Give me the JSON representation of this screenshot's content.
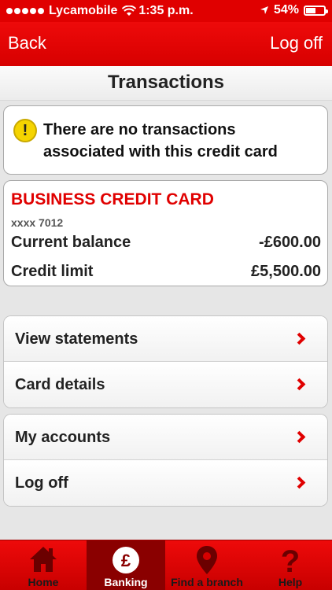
{
  "status_bar": {
    "carrier": "Lycamobile",
    "time": "1:35 p.m.",
    "battery": "54%"
  },
  "nav": {
    "back_label": "Back",
    "logoff_label": "Log off"
  },
  "page": {
    "title": "Transactions"
  },
  "info": {
    "message": "There are no transactions associated with this credit card"
  },
  "card": {
    "name": "BUSINESS CREDIT CARD",
    "number": "xxxx 7012",
    "balance_label": "Current balance",
    "balance_value": "-£600.00",
    "limit_label": "Credit limit",
    "limit_value": "£5,500.00"
  },
  "menu1": {
    "items": [
      {
        "label": "View statements"
      },
      {
        "label": "Card details"
      }
    ]
  },
  "menu2": {
    "items": [
      {
        "label": "My accounts"
      },
      {
        "label": "Log off"
      }
    ]
  },
  "tabs": [
    {
      "label": "Home",
      "icon": "home-icon"
    },
    {
      "label": "Banking",
      "icon": "pound-icon"
    },
    {
      "label": "Find a branch",
      "icon": "location-pin-icon"
    },
    {
      "label": "Help",
      "icon": "question-icon"
    }
  ],
  "colors": {
    "brand_red": "#e00000",
    "active_tab": "#8a0000"
  }
}
